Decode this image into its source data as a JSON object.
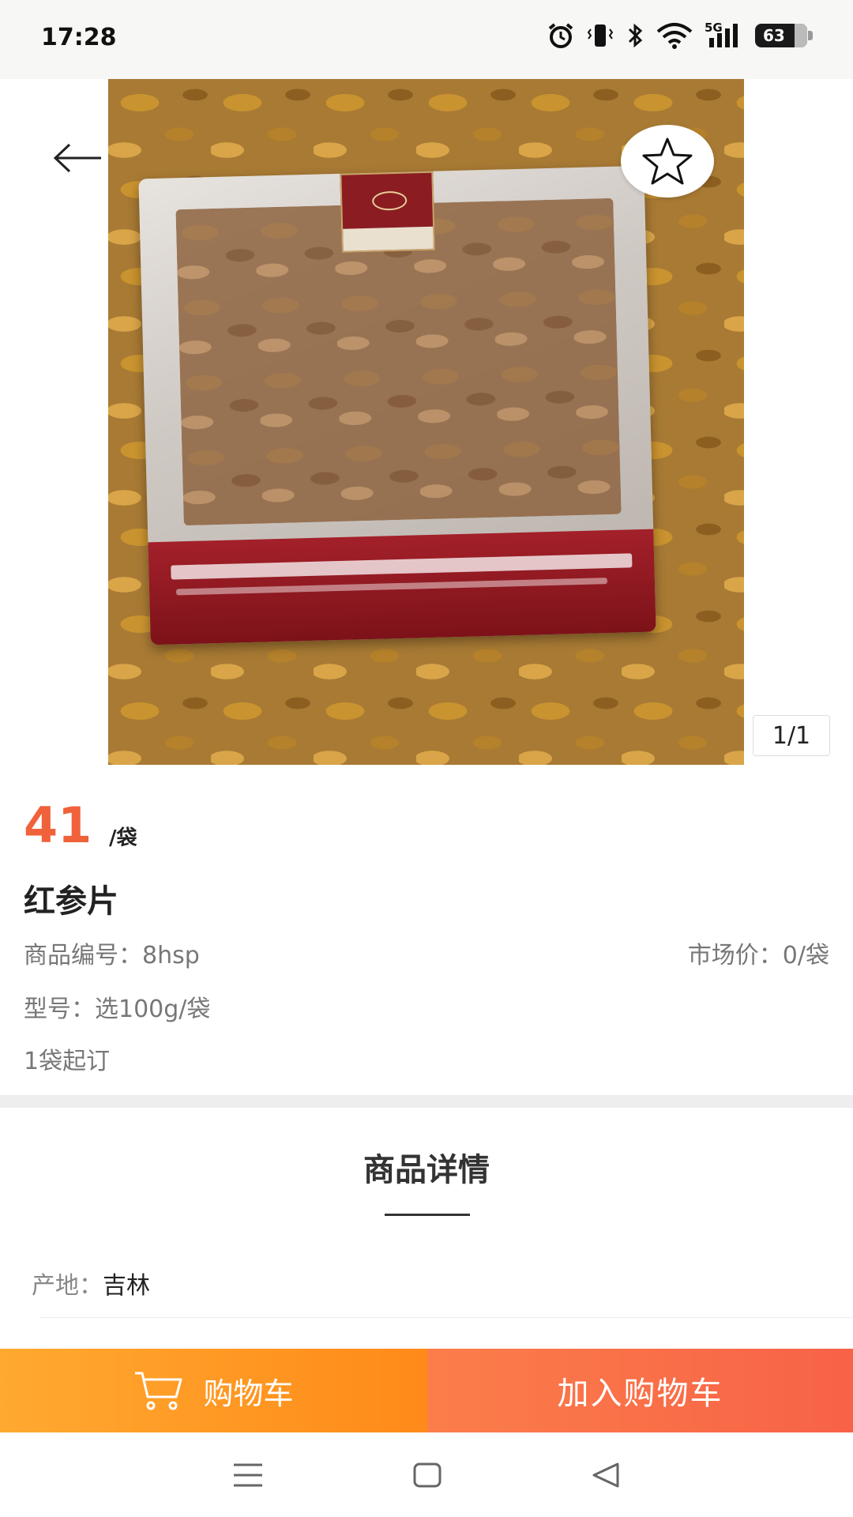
{
  "status_bar": {
    "time": "17:28",
    "network": "5G",
    "battery": "63",
    "icons": [
      "alarm-icon",
      "vibrate-icon",
      "bluetooth-icon",
      "wifi-icon",
      "signal-icon",
      "battery-icon"
    ]
  },
  "gallery": {
    "page_indicator": "1/1",
    "image_description_icons": [
      "back-arrow-icon",
      "star-icon"
    ]
  },
  "product": {
    "price": "41",
    "unit": "/袋",
    "name": "红参片",
    "code": "商品编号：8hsp",
    "market_price": "市场价：0/袋",
    "model": "型号：选100g/袋",
    "min_order": "1袋起订"
  },
  "details": {
    "title": "商品详情",
    "origin_label": "产地：",
    "origin_value": "吉林"
  },
  "actions": {
    "cart_label": "购物车",
    "add_to_cart_label": "加入购物车"
  },
  "colors": {
    "price": "#f0623a",
    "cart_button": "#ff9a23",
    "add_button": "#f96d48"
  }
}
